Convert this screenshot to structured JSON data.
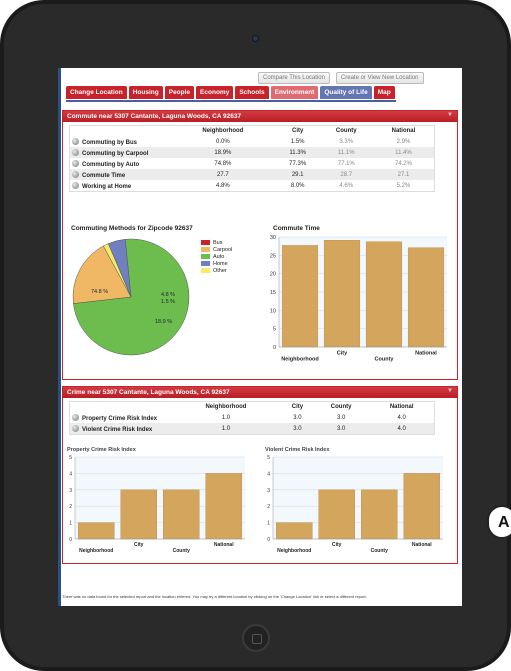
{
  "colors": {
    "accent": "#c8222b",
    "nav_blue": "#4a5f9f",
    "bar": "#d4a55c",
    "bus": "#c8222b",
    "carpool": "#f0b865",
    "auto": "#6cbd4d",
    "home": "#6f7fbf",
    "other": "#f4ee66"
  },
  "top_buttons": {
    "compare": "Compare This Location",
    "create": "Create or View New Location"
  },
  "tabs": [
    "Change Location",
    "Housing",
    "People",
    "Economy",
    "Schools",
    "Environment",
    "Quality of Life",
    "Map"
  ],
  "commute": {
    "title": "Commute near 5307 Cantante, Laguna Woods, CA 92637",
    "headers": [
      "Neighborhood",
      "City",
      "County",
      "National"
    ],
    "rows": [
      {
        "label": "Commuting by Bus",
        "values": [
          "0.0%",
          "1.5%",
          "3.3%",
          "2.9%"
        ]
      },
      {
        "label": "Commuting by Carpool",
        "values": [
          "18.9%",
          "11.3%",
          "11.1%",
          "11.4%"
        ]
      },
      {
        "label": "Commuting by Auto",
        "values": [
          "74.8%",
          "77.3%",
          "77.1%",
          "74.2%"
        ]
      },
      {
        "label": "Commute Time",
        "values": [
          "27.7",
          "29.1",
          "28.7",
          "27.1"
        ]
      },
      {
        "label": "Working at Home",
        "values": [
          "4.8%",
          "8.0%",
          "4.6%",
          "5.2%"
        ]
      }
    ]
  },
  "crime": {
    "title": "Crime near 5307 Cantante, Laguna Woods, CA 92637",
    "headers": [
      "Neighborhood",
      "City",
      "County",
      "National"
    ],
    "rows": [
      {
        "label": "Property Crime Risk Index",
        "values": [
          "1.0",
          "3.0",
          "3.0",
          "4.0"
        ]
      },
      {
        "label": "Violent Crime Risk Index",
        "values": [
          "1.0",
          "3.0",
          "3.0",
          "4.0"
        ]
      }
    ]
  },
  "chart_data": [
    {
      "type": "pie",
      "title": "Commuting Methods for Zipcode 92637",
      "categories": [
        "Bus",
        "Carpool",
        "Auto",
        "Home",
        "Other"
      ],
      "values": [
        0.0,
        18.9,
        74.8,
        4.8,
        1.5
      ],
      "data_labels": [
        "74.8 %",
        "18.9 %",
        "4.8 %",
        "1.5 %"
      ],
      "legend": "right"
    },
    {
      "type": "bar",
      "title": "Commute Time",
      "categories": [
        "Neighborhood",
        "City",
        "County",
        "National"
      ],
      "values": [
        27.7,
        29.1,
        28.7,
        27.1
      ],
      "yticks": [
        "0",
        "5",
        "10",
        "15",
        "20",
        "25",
        "30"
      ],
      "ylim": [
        0,
        30
      ],
      "grid": true
    },
    {
      "type": "bar",
      "title": "Property Crime Risk Index",
      "categories": [
        "Neighborhood",
        "City",
        "County",
        "National"
      ],
      "values": [
        1.0,
        3.0,
        3.0,
        4.0
      ],
      "yticks": [
        "0",
        "1",
        "2",
        "3",
        "4",
        "5"
      ],
      "ylim": [
        0,
        5
      ],
      "grid": true
    },
    {
      "type": "bar",
      "title": "Violent Crime Risk Index",
      "categories": [
        "Neighborhood",
        "City",
        "County",
        "National"
      ],
      "values": [
        1.0,
        3.0,
        3.0,
        4.0
      ],
      "yticks": [
        "0",
        "1",
        "2",
        "3",
        "4",
        "5"
      ],
      "ylim": [
        0,
        5
      ],
      "grid": true
    }
  ],
  "footer_note": "There was no data found for the selected report and the location entered. You may try a different location by clicking on the 'Change Location' link or select a different report.",
  "side_button_label": "A"
}
